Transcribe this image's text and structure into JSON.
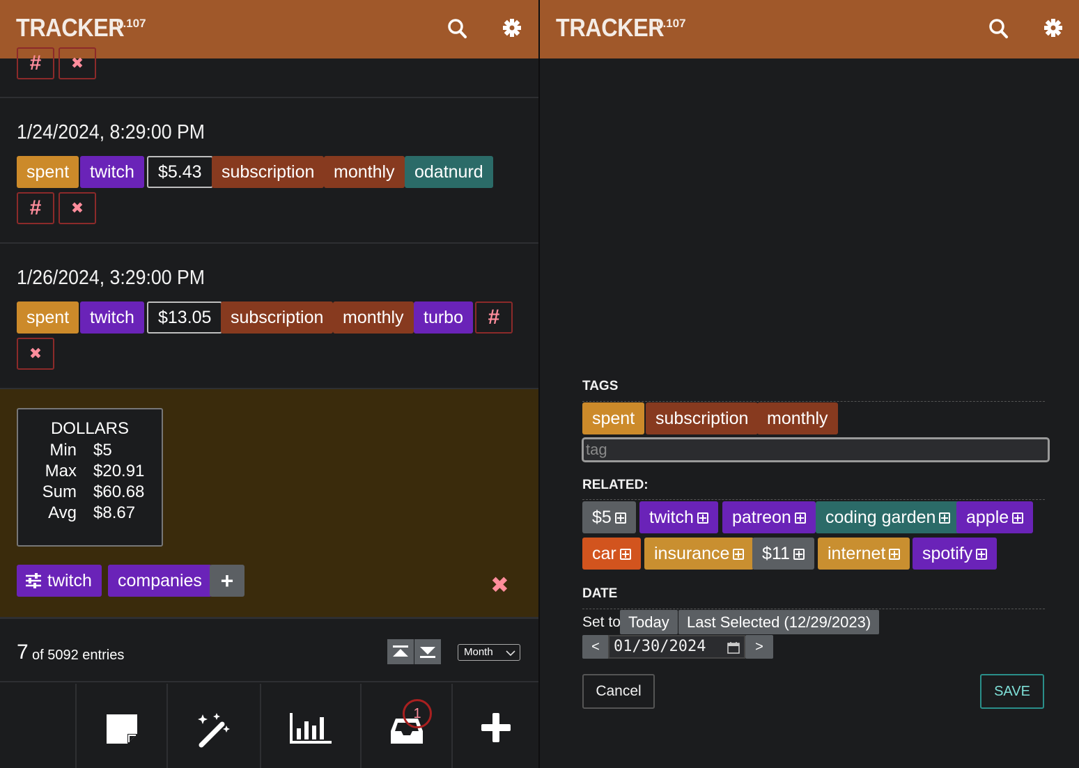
{
  "app": {
    "title": "TRACKER",
    "version": "0.107"
  },
  "icons": {
    "search": "search-icon",
    "settings": "gear-icon"
  },
  "entries": [
    {
      "when": "1/24/2024, 8:29:00 PM",
      "tags": [
        "spent",
        "twitch",
        "$5.43",
        "subscription",
        "monthly",
        "odatnurd"
      ]
    },
    {
      "when": "1/26/2024, 3:29:00 PM",
      "tags": [
        "spent",
        "twitch",
        "$13.05",
        "subscription",
        "monthly",
        "turbo"
      ]
    }
  ],
  "actions": {
    "hash": "#",
    "delete": "✖"
  },
  "stats": {
    "title": "DOLLARS",
    "rows": [
      {
        "label": "Min",
        "value": "$5"
      },
      {
        "label": "Max",
        "value": "$20.91"
      },
      {
        "label": "Sum",
        "value": "$60.68"
      },
      {
        "label": "Avg",
        "value": "$8.67"
      }
    ]
  },
  "filters": {
    "chips": [
      "twitch",
      "companies"
    ],
    "add": "+"
  },
  "footer": {
    "count": "7",
    "of_text": "of 5092 entries",
    "period": "Month"
  },
  "nav": {
    "inbox_badge": "1"
  },
  "editor": {
    "tags_label": "TAGS",
    "tags": [
      "spent",
      "subscription",
      "monthly"
    ],
    "tag_placeholder": "tag",
    "related_label": "RELATED:",
    "related": [
      "$5",
      "twitch",
      "patreon",
      "coding garden",
      "apple",
      "car",
      "insurance",
      "$11",
      "internet",
      "spotify"
    ],
    "date_label": "DATE",
    "set_to": "Set to:",
    "today": "Today",
    "last_selected": "Last Selected (12/29/2023)",
    "prev": "<",
    "next": ">",
    "date_value": "01/30/2024",
    "cancel": "Cancel",
    "save": "SAVE"
  },
  "colors": {
    "header": "#a0582a",
    "spent": "#cc8a2a",
    "purple": "#6a23b8",
    "brown": "#873a1f",
    "teal": "#2b6b68",
    "summary_bg": "#3a2b0c"
  }
}
